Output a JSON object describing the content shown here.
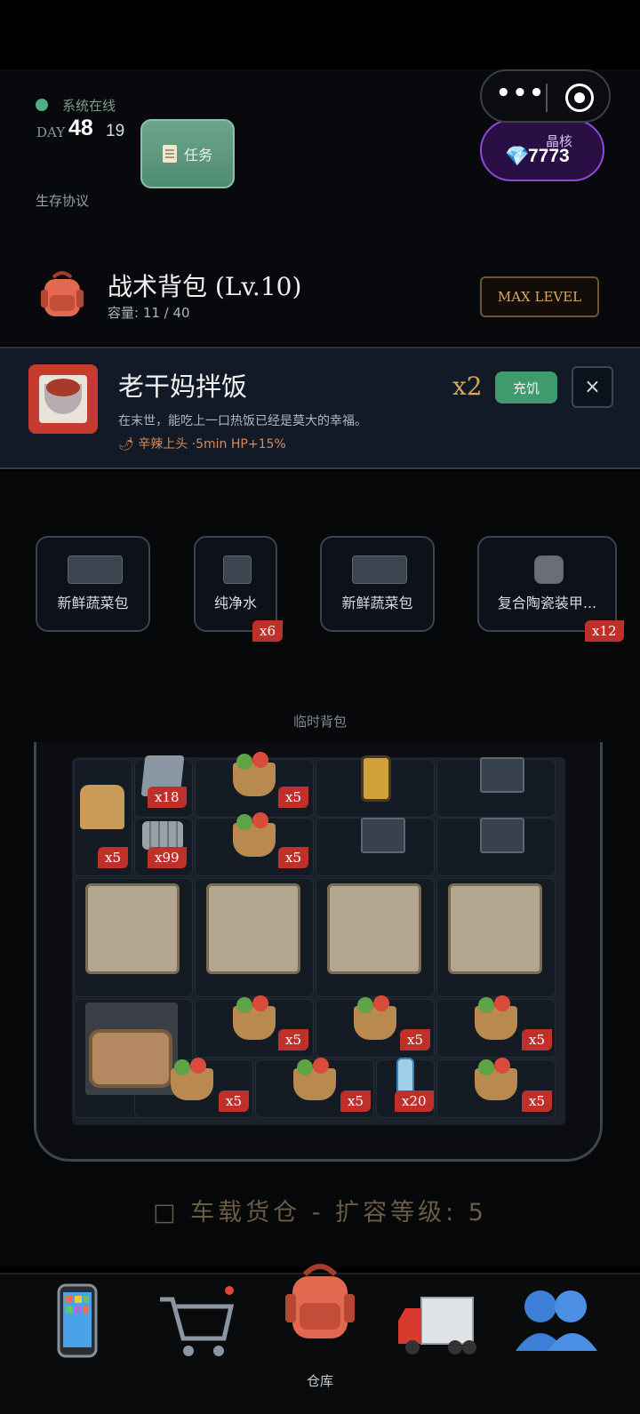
{
  "header": {
    "status_text": "系统在线",
    "day_label": "DAY",
    "day_number": "48",
    "day_sub": "19",
    "task_label": "任务",
    "protocol_label": "生存协议",
    "crystal_label": "晶核",
    "crystal_value": "7773",
    "crystal_gem": "💎"
  },
  "backpack": {
    "title": "战术背包 (Lv.10)",
    "capacity": "容量:  11  /  40",
    "max_level_label": "MAX LEVEL"
  },
  "selected_item": {
    "name": "老干妈拌饭",
    "description": "在末世，能吃上一口热饭已经是莫大的幸福。",
    "effect": "🌶 辛辣上头 ·5min HP+15%",
    "count": "x2",
    "action_label": "充饥",
    "close_glyph": "×"
  },
  "temp_bag": {
    "label": "临时背包",
    "items": [
      {
        "label": "新鲜蔬菜包",
        "count": "",
        "icon": "vegetable-basket-icon"
      },
      {
        "label": "纯净水",
        "count": "x6",
        "icon": "water-bottle-icon"
      },
      {
        "label": "新鲜蔬菜包",
        "count": "",
        "icon": "vegetable-basket-icon"
      },
      {
        "label": "复合陶瓷装甲...",
        "count": "x12",
        "icon": "ceramic-plate-icon"
      }
    ]
  },
  "cargo": {
    "label": "□  车载货仓  -  扩容等级:  5",
    "counts": {
      "bread": "x5",
      "glass": "x18",
      "veg1": "x5",
      "steel": "x99",
      "veg2": "x5",
      "veg3": "x5",
      "veg4": "x5",
      "veg5": "x5",
      "veg6": "x5",
      "veg7": "x5",
      "water": "x20",
      "veg8": "x5"
    }
  },
  "nav": {
    "active_label": "仓库",
    "items": [
      "phone-icon",
      "shopping-cart-icon",
      "backpack-icon",
      "truck-icon",
      "team-icon"
    ]
  },
  "colors": {
    "accent_green": "#3f9b6e",
    "badge_red": "#c0302a",
    "crystal_purple": "#8f4ad8",
    "gold": "#d6a556"
  }
}
